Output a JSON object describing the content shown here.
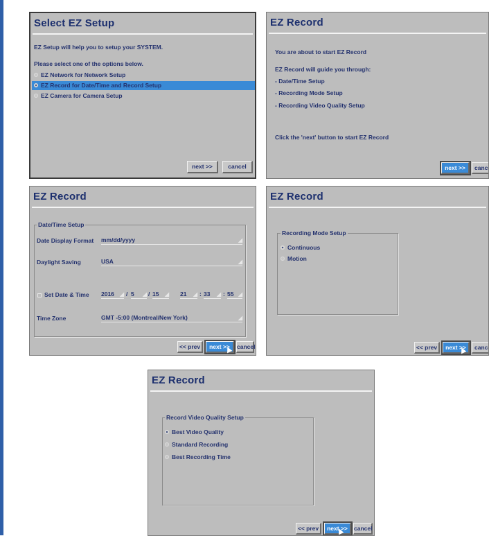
{
  "panel1": {
    "title": "Select EZ Setup",
    "line1": "EZ Setup will help you to setup your SYSTEM.",
    "line2": "Please select one of the options below.",
    "options": [
      "EZ Network for Network Setup",
      "EZ Record for Date/Time and Record Setup",
      "EZ Camera for Camera Setup"
    ],
    "selected_index": 1,
    "next": "next >>",
    "cancel": "cancel"
  },
  "panel2": {
    "title": "EZ Record",
    "line1": "You are about to start EZ Record",
    "line2": "EZ Record will guide you through:",
    "steps": [
      "- Date/Time Setup",
      "- Recording Mode Setup",
      "- Recording Video Quality Setup"
    ],
    "line3": "Click the 'next' button to start EZ Record",
    "next": "next >>",
    "cancel": "cancel"
  },
  "panel3": {
    "title": "EZ Record",
    "group": "Date/Time Setup",
    "date_format_label": "Date Display Format",
    "date_format_value": "mm/dd/yyyy",
    "dst_label": "Daylight Saving",
    "dst_value": "USA",
    "set_date_label": "Set Date & Time",
    "year": "2016",
    "month": "5",
    "day": "15",
    "hour": "21",
    "minute": "33",
    "second": "55",
    "tz_label": "Time Zone",
    "tz_value": "GMT -5:00 (Montreal/New York)",
    "prev": "<< prev",
    "next": "next >>",
    "cancel": "cancel"
  },
  "panel4": {
    "title": "EZ Record",
    "group": "Recording Mode Setup",
    "options": [
      "Continuous",
      "Motion"
    ],
    "selected_index": 0,
    "prev": "<< prev",
    "next": "next >>",
    "cancel": "cancel"
  },
  "panel5": {
    "title": "EZ Record",
    "group": "Record Video Quality Setup",
    "options": [
      "Best Video Quality",
      "Standard Recording",
      "Best Recording Time"
    ],
    "selected_index": 0,
    "prev": "<< prev",
    "next": "next >>",
    "cancel": "cancel"
  },
  "colors": {
    "accent": "#3a8ad6",
    "panel_bg": "#bdbdbd",
    "text": "#24326e",
    "title": "#1c2f6e",
    "left_bar": "#2f5fa8"
  },
  "icons": [
    "radio-icon",
    "dropdown-arrow-icon",
    "checkbox-icon",
    "mouse-cursor-icon"
  ]
}
